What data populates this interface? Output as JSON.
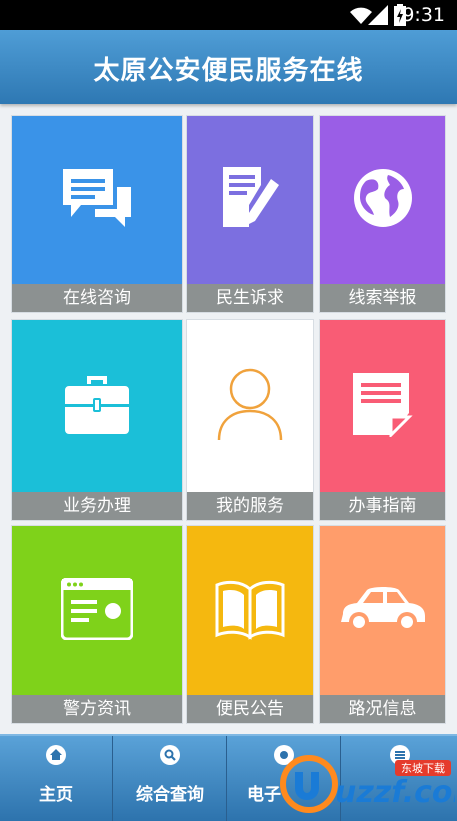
{
  "status_bar": {
    "time": "9:31"
  },
  "header": {
    "title": "太原公安便民服务在线"
  },
  "tiles": [
    {
      "label": "在线咨询",
      "icon": "chat-bubbles-icon",
      "color": "#3a93e8"
    },
    {
      "label": "民生诉求",
      "icon": "document-pen-icon",
      "color": "#7c6fe0"
    },
    {
      "label": "线索举报",
      "icon": "globe-icon",
      "color": "#9a5ee6"
    },
    {
      "label": "业务办理",
      "icon": "briefcase-icon",
      "color": "#1bbfd8"
    },
    {
      "label": "我的服务",
      "icon": "user-icon",
      "color": "#ffffff"
    },
    {
      "label": "办事指南",
      "icon": "guide-document-icon",
      "color": "#f95c75"
    },
    {
      "label": "警方资讯",
      "icon": "browser-window-icon",
      "color": "#7fd21a"
    },
    {
      "label": "便民公告",
      "icon": "open-book-icon",
      "color": "#f5b80f"
    },
    {
      "label": "路况信息",
      "icon": "car-icon",
      "color": "#ff9d6b"
    }
  ],
  "tab_bar": {
    "tabs": [
      {
        "label": "主页",
        "icon": "home-icon"
      },
      {
        "label": "综合查询",
        "icon": "search-icon"
      },
      {
        "label": "电子",
        "icon": "circle-icon"
      },
      {
        "label": "",
        "icon": "menu-icon"
      }
    ]
  },
  "watermark": {
    "text": "uzzf.com",
    "subtext": "东坡下载"
  }
}
